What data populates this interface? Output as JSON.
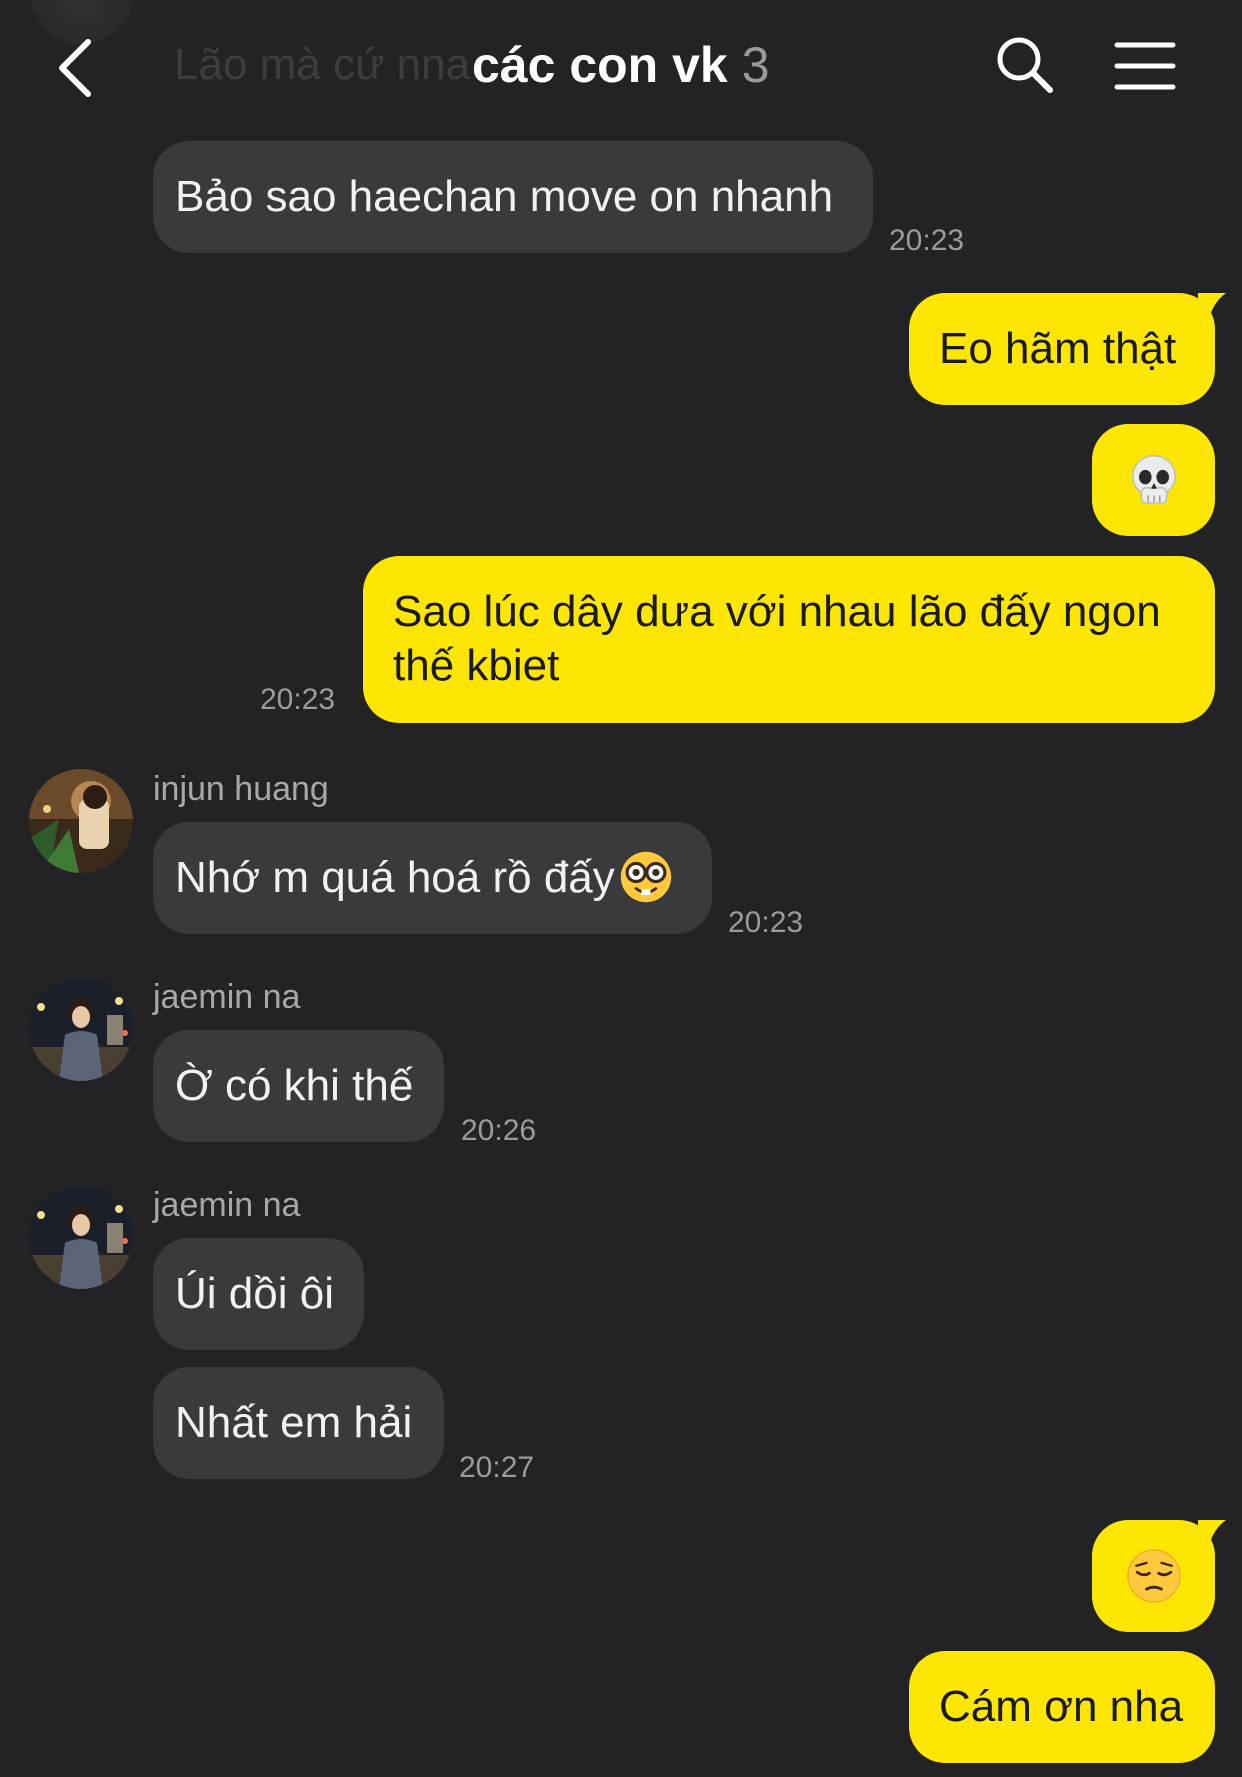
{
  "header": {
    "behind_text": "Lão mà cứ nna",
    "title": "các con vk",
    "member_count": "3"
  },
  "messages": [
    {
      "id": "m1",
      "direction": "incoming",
      "text": "Bảo sao haechan move on nhanh",
      "time": "20:23"
    },
    {
      "id": "m2",
      "direction": "outgoing",
      "text": "Eo hãm thật"
    },
    {
      "id": "m3",
      "direction": "outgoing",
      "emoji": "skull"
    },
    {
      "id": "m4",
      "direction": "outgoing",
      "text_line1": "Sao lúc dây dưa với nhau lão đấy ngon",
      "text_line2": "thế kbiet",
      "time": "20:23"
    },
    {
      "id": "m5",
      "direction": "incoming",
      "sender": "injun huang",
      "text": "Nhớ m quá hoá rồ đấy",
      "emoji": "nerd-face",
      "time": "20:23"
    },
    {
      "id": "m6",
      "direction": "incoming",
      "sender": "jaemin na",
      "text": "Ờ có khi thế",
      "time": "20:26"
    },
    {
      "id": "m7",
      "direction": "incoming",
      "sender": "jaemin na",
      "text": "Úi dồi ôi"
    },
    {
      "id": "m8",
      "direction": "incoming",
      "text": "Nhất em hải",
      "time": "20:27"
    },
    {
      "id": "m9",
      "direction": "outgoing",
      "emoji": "pensive-face"
    },
    {
      "id": "m10",
      "direction": "outgoing",
      "text": "Cám ơn nha"
    }
  ],
  "colors": {
    "background": "#232325",
    "incoming_bubble": "#3a3a3c",
    "outgoing_bubble": "#fde603"
  }
}
